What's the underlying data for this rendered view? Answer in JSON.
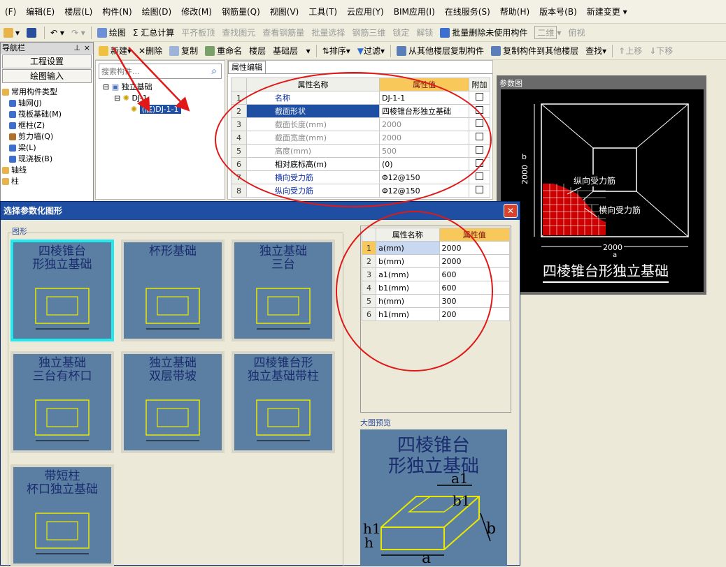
{
  "menu": [
    "(F)",
    "编辑(E)",
    "楼层(L)",
    "构件(N)",
    "绘图(D)",
    "修改(M)",
    "钢筋量(Q)",
    "视图(V)",
    "工具(T)",
    "云应用(Y)",
    "BIM应用(I)",
    "在线服务(S)",
    "帮助(H)",
    "版本号(B)",
    "新建变更 ▾"
  ],
  "toolbar1": {
    "draw": "绘图",
    "summary": "Σ 汇总计算",
    "flat_roof": "平齐板顶",
    "find": "查找图元",
    "view_rebar": "查看钢筋量",
    "batch_select": "批量选择",
    "rebar_3d": "钢筋三维",
    "lock": "锁定",
    "unlock": "解锁",
    "batch_delete": "批量删除未使用构件",
    "view_2d": "二维",
    "top_view": "俯视"
  },
  "toolbar2": {
    "new": "新建",
    "delete": "删除",
    "copy": "复制",
    "rename": "重命名",
    "floor_label": "楼层",
    "floor_value": "基础层",
    "sort": "排序",
    "filter": "过滤",
    "copy_from": "从其他楼层复制构件",
    "copy_to": "复制构件到其他楼层",
    "find": "查找",
    "up": "上移",
    "down": "下移"
  },
  "nav": {
    "title": "导航栏",
    "pin": "ᵖ",
    "close": "×",
    "btn_settings": "工程设置",
    "btn_draw": "绘图输入",
    "items": [
      "常用构件类型",
      "轴网(J)",
      "筏板基础(M)",
      "框柱(Z)",
      "剪力墙(Q)",
      "梁(L)",
      "现浇板(B)",
      "轴线",
      "柱"
    ]
  },
  "tree": {
    "search_placeholder": "搜索构件...",
    "root": "独立基础",
    "child": "DJ-1",
    "leaf": "(底)DJ-1-1"
  },
  "props": {
    "tab": "属性编辑",
    "head_name": "属性名称",
    "head_value": "属性值",
    "head_extra": "附加",
    "rows": [
      {
        "n": "1",
        "name": "名称",
        "value": "DJ-1-1",
        "style": "blue"
      },
      {
        "n": "2",
        "name": "截面形状",
        "value": "四棱锥台形独立基础",
        "style": "sel"
      },
      {
        "n": "3",
        "name": "截面长度(mm)",
        "value": "2000",
        "style": "grey"
      },
      {
        "n": "4",
        "name": "截面宽度(mm)",
        "value": "2000",
        "style": "grey"
      },
      {
        "n": "5",
        "name": "高度(mm)",
        "value": "500",
        "style": "grey"
      },
      {
        "n": "6",
        "name": "相对底标高(m)",
        "value": "(0)",
        "style": ""
      },
      {
        "n": "7",
        "name": "横向受力筋",
        "value": "Φ12@150",
        "style": "blue"
      },
      {
        "n": "8",
        "name": "纵向受力筋",
        "value": "Φ12@150",
        "style": "blue"
      }
    ]
  },
  "param_view": {
    "title": "参数图",
    "dim_b": "2000",
    "dim_b_label": "b",
    "dim_a": "2000",
    "dim_a_label": "a",
    "label_long": "纵向受力筋",
    "label_trans": "横向受力筋",
    "caption": "四棱锥台形独立基础"
  },
  "dialog": {
    "title": "选择参数化图形",
    "close": "✕",
    "group": "图形",
    "preview_label": "大图预览",
    "shapes": [
      "四棱锥台\n形独立基础",
      "杯形基础",
      "独立基础\n三台",
      "独立基础\n三台有杯口",
      "独立基础\n双层带坡",
      "四棱锥台形\n独立基础带柱",
      "带短柱\n杯口独立基础"
    ],
    "preview_title": "四棱锥台\n形独立基础",
    "param_head_name": "属性名称",
    "param_head_value": "属性值",
    "params": [
      {
        "n": "1",
        "name": "a(mm)",
        "value": "2000"
      },
      {
        "n": "2",
        "name": "b(mm)",
        "value": "2000"
      },
      {
        "n": "3",
        "name": "a1(mm)",
        "value": "600"
      },
      {
        "n": "4",
        "name": "b1(mm)",
        "value": "600"
      },
      {
        "n": "5",
        "name": "h(mm)",
        "value": "300"
      },
      {
        "n": "6",
        "name": "h1(mm)",
        "value": "200"
      }
    ]
  },
  "colors": {
    "accent_blue": "#1e4fa3",
    "highlight": "#f8c85a",
    "annotation_red": "#e01818",
    "card_bg": "#5b7fa3",
    "card_sel": "#22e8f0"
  }
}
